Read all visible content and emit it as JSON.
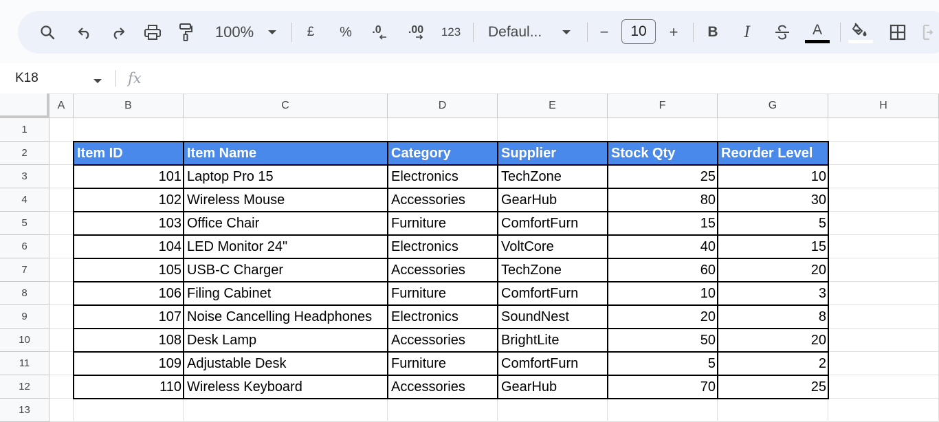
{
  "toolbar": {
    "zoom": "100%",
    "currency": "£",
    "percent": "%",
    "decrease_decimal": ".0",
    "increase_decimal": ".00",
    "number_format": "123",
    "font": "Defaul...",
    "font_size": "10",
    "minus": "−",
    "plus": "+",
    "bold": "B",
    "italic": "I",
    "text_color_glyph": "A",
    "text_color": "#000000",
    "icons": [
      "search-icon",
      "undo-icon",
      "redo-icon",
      "print-icon",
      "paint-format-icon",
      "chevron-down-icon",
      "strikethrough-icon",
      "fill-color-icon",
      "borders-icon",
      "merge-cells-icon"
    ]
  },
  "formula_bar": {
    "cell_ref": "K18",
    "fx": "fx",
    "value": ""
  },
  "sheet": {
    "columns": [
      "A",
      "B",
      "C",
      "D",
      "E",
      "F",
      "G",
      "H"
    ],
    "rows": [
      "1",
      "2",
      "3",
      "4",
      "5",
      "6",
      "7",
      "8",
      "9",
      "10",
      "11",
      "12",
      "13"
    ],
    "header_color": "#4a89ec",
    "table_headers": [
      "Item ID",
      "Item Name",
      "Category",
      "Supplier",
      "Stock Qty",
      "Reorder Level"
    ],
    "table_rows": [
      [
        "101",
        "Laptop Pro 15",
        "Electronics",
        "TechZone",
        "25",
        "10"
      ],
      [
        "102",
        "Wireless Mouse",
        "Accessories",
        "GearHub",
        "80",
        "30"
      ],
      [
        "103",
        "Office Chair",
        "Furniture",
        "ComfortFurn",
        "15",
        "5"
      ],
      [
        "104",
        "LED Monitor 24\"",
        "Electronics",
        "VoltCore",
        "40",
        "15"
      ],
      [
        "105",
        "USB-C Charger",
        "Accessories",
        "TechZone",
        "60",
        "20"
      ],
      [
        "106",
        "Filing Cabinet",
        "Furniture",
        "ComfortFurn",
        "10",
        "3"
      ],
      [
        "107",
        "Noise Cancelling Headphones",
        "Electronics",
        "SoundNest",
        "20",
        "8"
      ],
      [
        "108",
        "Desk Lamp",
        "Accessories",
        "BrightLite",
        "50",
        "20"
      ],
      [
        "109",
        "Adjustable Desk",
        "Furniture",
        "ComfortFurn",
        "5",
        "2"
      ],
      [
        "110",
        "Wireless Keyboard",
        "Accessories",
        "GearHub",
        "70",
        "25"
      ]
    ]
  }
}
